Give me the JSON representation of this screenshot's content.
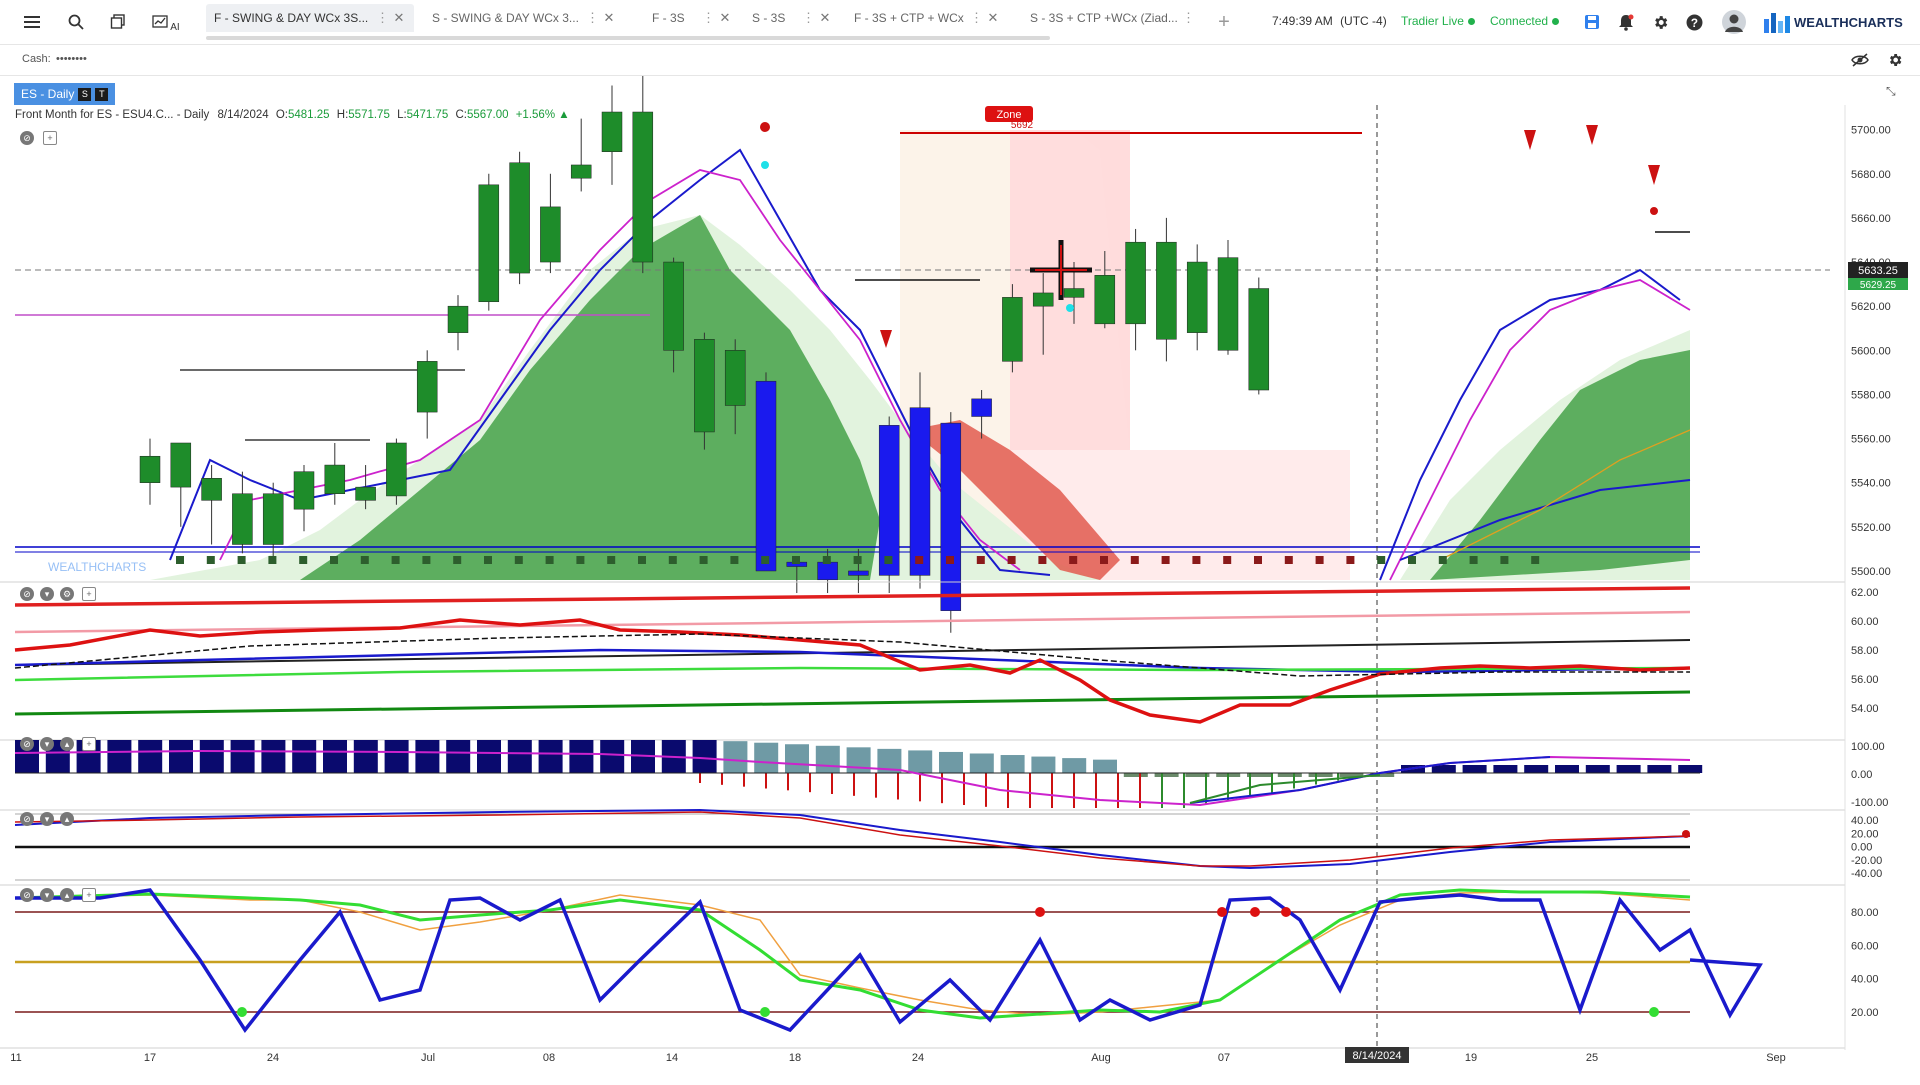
{
  "topbar": {
    "menu_icon": "hamburger-icon",
    "search_icon": "search-icon",
    "layouts_icon": "layers-icon",
    "ai_label": "AI",
    "tabs": [
      {
        "label": "F - SWING & DAY WCx 3S...",
        "active": true
      },
      {
        "label": "S - SWING & DAY WCx 3...",
        "active": false
      },
      {
        "label": "F - 3S",
        "active": false
      },
      {
        "label": "S - 3S",
        "active": false
      },
      {
        "label": "F - 3S + CTP + WCx",
        "active": false
      },
      {
        "label": "S - 3S + CTP +WCx (Ziad...",
        "active": false
      }
    ],
    "add_tab": "+",
    "time": "7:49:39 AM",
    "timezone": "(UTC -4)",
    "tradier_status": "Tradier Live",
    "connection_status": "Connected",
    "brand": "WEALTHCHARTS"
  },
  "cashbar": {
    "label": "Cash:",
    "value": "••••••••"
  },
  "chart": {
    "symbol_badge": "ES - Daily",
    "badge_s": "S",
    "badge_t": "T",
    "ohlc_prefix": "Front Month for ES - ESU4.C... - Daily",
    "date": "8/14/2024",
    "open": "5481.25",
    "high": "5571.75",
    "low": "5471.75",
    "close": "5567.00",
    "change": "+1.56%",
    "zone_label": "Zone",
    "zone_value": "5692",
    "crosshair_date": "8/14/2024",
    "current_price": "5633.25",
    "price_secondary": "5629.25",
    "watermark": "WEALTHCHARTS"
  },
  "chart_data": [
    {
      "type": "candlestick",
      "name": "ES - Daily",
      "ylim": [
        5495,
        5708
      ],
      "y_ticks": [
        5500,
        5520,
        5540,
        5560,
        5580,
        5600,
        5620,
        5640,
        5660,
        5680,
        5700
      ],
      "x_ticks": [
        "11",
        "17",
        "24",
        "Jul",
        "08",
        "14",
        "18",
        "24",
        "Aug",
        "07",
        "19",
        "25",
        "Sep"
      ],
      "candles": [
        {
          "o": 5552,
          "h": 5560,
          "l": 5530,
          "c": 5540
        },
        {
          "o": 5538,
          "h": 5552,
          "l": 5520,
          "c": 5558
        },
        {
          "o": 5542,
          "h": 5548,
          "l": 5512,
          "c": 5532
        },
        {
          "o": 5535,
          "h": 5545,
          "l": 5508,
          "c": 5512
        },
        {
          "o": 5512,
          "h": 5540,
          "l": 5505,
          "c": 5535
        },
        {
          "o": 5528,
          "h": 5548,
          "l": 5518,
          "c": 5545
        },
        {
          "o": 5548,
          "h": 5558,
          "l": 5530,
          "c": 5535
        },
        {
          "o": 5538,
          "h": 5548,
          "l": 5528,
          "c": 5532
        },
        {
          "o": 5534,
          "h": 5560,
          "l": 5530,
          "c": 5558
        },
        {
          "o": 5572,
          "h": 5600,
          "l": 5560,
          "c": 5595
        },
        {
          "o": 5608,
          "h": 5625,
          "l": 5600,
          "c": 5620
        },
        {
          "o": 5622,
          "h": 5680,
          "l": 5618,
          "c": 5675
        },
        {
          "o": 5635,
          "h": 5690,
          "l": 5630,
          "c": 5685
        },
        {
          "o": 5640,
          "h": 5680,
          "l": 5635,
          "c": 5665
        },
        {
          "o": 5678,
          "h": 5705,
          "l": 5672,
          "c": 5684
        },
        {
          "o": 5690,
          "h": 5720,
          "l": 5675,
          "c": 5712
        },
        {
          "o": 5730,
          "h": 5735,
          "l": 5635,
          "c": 5640
        },
        {
          "o": 5640,
          "h": 5642,
          "l": 5590,
          "c": 5600
        },
        {
          "o": 5605,
          "h": 5608,
          "l": 5555,
          "c": 5563
        },
        {
          "o": 5600,
          "h": 5605,
          "l": 5562,
          "c": 5575
        },
        {
          "o": 5586,
          "h": 5590,
          "l": 5520,
          "c": 5500
        },
        {
          "o": 5504,
          "h": 5505,
          "l": 5490,
          "c": 5502
        },
        {
          "o": 5496,
          "h": 5510,
          "l": 5490,
          "c": 5504
        },
        {
          "o": 5500,
          "h": 5510,
          "l": 5490,
          "c": 5498
        },
        {
          "o": 5498,
          "h": 5570,
          "l": 5490,
          "c": 5566
        },
        {
          "o": 5498,
          "h": 5590,
          "l": 5492,
          "c": 5574
        },
        {
          "o": 5482,
          "h": 5572,
          "l": 5472,
          "c": 5567
        },
        {
          "o": 5570,
          "h": 5582,
          "l": 5560,
          "c": 5578
        },
        {
          "o": 5595,
          "h": 5630,
          "l": 5590,
          "c": 5624
        },
        {
          "o": 5620,
          "h": 5635,
          "l": 5598,
          "c": 5626
        },
        {
          "o": 5624,
          "h": 5640,
          "l": 5612,
          "c": 5628
        },
        {
          "o": 5634,
          "h": 5645,
          "l": 5610,
          "c": 5612
        },
        {
          "o": 5612,
          "h": 5655,
          "l": 5600,
          "c": 5649
        },
        {
          "o": 5605,
          "h": 5660,
          "l": 5595,
          "c": 5649
        },
        {
          "o": 5608,
          "h": 5648,
          "l": 5600,
          "c": 5640
        },
        {
          "o": 5642,
          "h": 5650,
          "l": 5598,
          "c": 5600
        },
        {
          "o": 5628,
          "h": 5633,
          "l": 5580,
          "c": 5582
        }
      ]
    },
    {
      "type": "line",
      "name": "indicator-1",
      "y_ticks": [
        62,
        60,
        58,
        56,
        54
      ]
    },
    {
      "type": "bar",
      "name": "indicator-2",
      "y_ticks": [
        100,
        0,
        -100
      ]
    },
    {
      "type": "line",
      "name": "indicator-3",
      "y_ticks": [
        40,
        20,
        0,
        -20,
        -40
      ]
    },
    {
      "type": "line",
      "name": "indicator-4",
      "y_ticks": [
        80,
        60,
        40,
        20
      ]
    }
  ]
}
